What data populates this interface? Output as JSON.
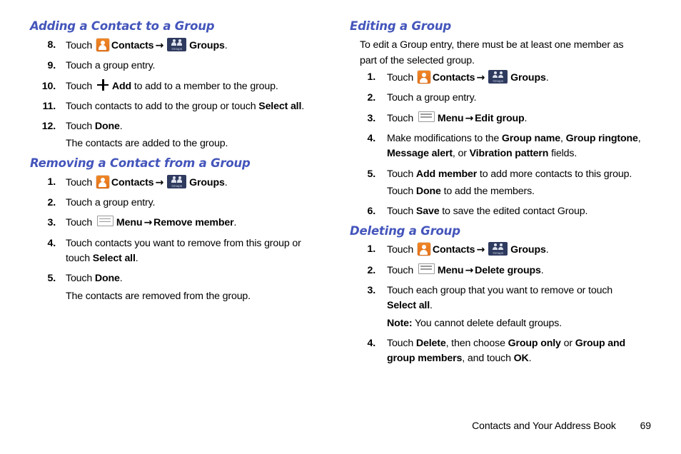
{
  "icons": {
    "contacts": "contacts-icon",
    "groups": "groups-icon",
    "groups_label": "Groups",
    "menu": "menu-icon",
    "add": "add-plus-icon",
    "arrow": "→"
  },
  "colors": {
    "heading_blue": "#4455bb",
    "contacts_icon_orange": "#ef8626",
    "groups_icon_navy": "#2f3a5f",
    "menu_icon_gray": "#9a9a9a",
    "text_black": "#000000",
    "page_background": "#ffffff"
  },
  "left_column": {
    "section1": {
      "heading": "Adding a Contact to a Group",
      "steps": [
        {
          "num": "8.",
          "parts": [
            {
              "t": "text",
              "v": "Touch "
            },
            {
              "t": "icon",
              "v": "contacts"
            },
            {
              "t": "bold",
              "v": "Contacts"
            },
            {
              "t": "arrow"
            },
            {
              "t": "icon",
              "v": "groups"
            },
            {
              "t": "bold",
              "v": "Groups"
            },
            {
              "t": "text",
              "v": "."
            }
          ]
        },
        {
          "num": "9.",
          "parts": [
            {
              "t": "text",
              "v": "Touch a group entry."
            }
          ]
        },
        {
          "num": "10.",
          "parts": [
            {
              "t": "text",
              "v": "Touch "
            },
            {
              "t": "icon",
              "v": "add"
            },
            {
              "t": "bold",
              "v": "Add"
            },
            {
              "t": "text",
              "v": " to add to a member to the group."
            }
          ]
        },
        {
          "num": "11.",
          "parts": [
            {
              "t": "text",
              "v": "Touch contacts to add to the group or touch "
            },
            {
              "t": "bold",
              "v": "Select all"
            },
            {
              "t": "text",
              "v": "."
            }
          ]
        },
        {
          "num": "12.",
          "parts": [
            {
              "t": "text",
              "v": "Touch "
            },
            {
              "t": "bold",
              "v": "Done"
            },
            {
              "t": "text",
              "v": "."
            },
            {
              "t": "br"
            },
            {
              "t": "text",
              "v": "The contacts are added to the group."
            }
          ]
        }
      ]
    },
    "section2": {
      "heading": "Removing a Contact from a Group",
      "steps": [
        {
          "num": "1.",
          "parts": [
            {
              "t": "text",
              "v": "Touch "
            },
            {
              "t": "icon",
              "v": "contacts"
            },
            {
              "t": "bold",
              "v": "Contacts"
            },
            {
              "t": "arrow"
            },
            {
              "t": "icon",
              "v": "groups"
            },
            {
              "t": "bold",
              "v": "Groups"
            },
            {
              "t": "text",
              "v": "."
            }
          ]
        },
        {
          "num": "2.",
          "parts": [
            {
              "t": "text",
              "v": "Touch a group entry."
            }
          ]
        },
        {
          "num": "3.",
          "parts": [
            {
              "t": "text",
              "v": "Touch "
            },
            {
              "t": "icon",
              "v": "menu"
            },
            {
              "t": "bold",
              "v": "Menu"
            },
            {
              "t": "arrow"
            },
            {
              "t": "bold",
              "v": "Remove member"
            },
            {
              "t": "text",
              "v": "."
            }
          ]
        },
        {
          "num": "4.",
          "parts": [
            {
              "t": "text",
              "v": "Touch contacts you want to remove from this group or touch "
            },
            {
              "t": "bold",
              "v": "Select all"
            },
            {
              "t": "text",
              "v": "."
            }
          ]
        },
        {
          "num": "5.",
          "parts": [
            {
              "t": "text",
              "v": "Touch "
            },
            {
              "t": "bold",
              "v": "Done"
            },
            {
              "t": "text",
              "v": "."
            },
            {
              "t": "br"
            },
            {
              "t": "text",
              "v": "The contacts are removed from the group."
            }
          ]
        }
      ]
    }
  },
  "right_column": {
    "section1": {
      "heading": "Editing a Group",
      "intro": "To edit a Group entry, there must be at least one member as part of the selected group.",
      "steps": [
        {
          "num": "1.",
          "parts": [
            {
              "t": "text",
              "v": "Touch "
            },
            {
              "t": "icon",
              "v": "contacts"
            },
            {
              "t": "bold",
              "v": "Contacts"
            },
            {
              "t": "arrow"
            },
            {
              "t": "icon",
              "v": "groups"
            },
            {
              "t": "bold",
              "v": "Groups"
            },
            {
              "t": "text",
              "v": "."
            }
          ]
        },
        {
          "num": "2.",
          "parts": [
            {
              "t": "text",
              "v": "Touch a group entry."
            }
          ]
        },
        {
          "num": "3.",
          "parts": [
            {
              "t": "text",
              "v": "Touch "
            },
            {
              "t": "icon",
              "v": "menu"
            },
            {
              "t": "bold",
              "v": "Menu"
            },
            {
              "t": "arrow"
            },
            {
              "t": "bold",
              "v": "Edit group"
            },
            {
              "t": "text",
              "v": "."
            }
          ]
        },
        {
          "num": "4.",
          "parts": [
            {
              "t": "text",
              "v": "Make modifications to the "
            },
            {
              "t": "bold",
              "v": "Group name"
            },
            {
              "t": "text",
              "v": ", "
            },
            {
              "t": "bold",
              "v": "Group ringtone"
            },
            {
              "t": "text",
              "v": ", "
            },
            {
              "t": "bold",
              "v": "Message alert"
            },
            {
              "t": "text",
              "v": ", or "
            },
            {
              "t": "bold",
              "v": "Vibration pattern"
            },
            {
              "t": "text",
              "v": " fields."
            }
          ]
        },
        {
          "num": "5.",
          "parts": [
            {
              "t": "text",
              "v": "Touch "
            },
            {
              "t": "bold",
              "v": "Add member"
            },
            {
              "t": "text",
              "v": " to add more contacts to this group."
            },
            {
              "t": "br"
            },
            {
              "t": "text",
              "v": "Touch "
            },
            {
              "t": "bold",
              "v": "Done"
            },
            {
              "t": "text",
              "v": " to add the members."
            }
          ]
        },
        {
          "num": "6.",
          "parts": [
            {
              "t": "text",
              "v": "Touch "
            },
            {
              "t": "bold",
              "v": "Save"
            },
            {
              "t": "text",
              "v": " to save the edited contact Group."
            }
          ]
        }
      ]
    },
    "section2": {
      "heading": "Deleting a Group",
      "steps": [
        {
          "num": "1.",
          "parts": [
            {
              "t": "text",
              "v": "Touch "
            },
            {
              "t": "icon",
              "v": "contacts"
            },
            {
              "t": "bold",
              "v": "Contacts"
            },
            {
              "t": "arrow"
            },
            {
              "t": "icon",
              "v": "groups"
            },
            {
              "t": "bold",
              "v": "Groups"
            },
            {
              "t": "text",
              "v": "."
            }
          ]
        },
        {
          "num": "2.",
          "parts": [
            {
              "t": "text",
              "v": "Touch "
            },
            {
              "t": "icon",
              "v": "menu"
            },
            {
              "t": "bold",
              "v": "Menu"
            },
            {
              "t": "arrow"
            },
            {
              "t": "bold",
              "v": "Delete groups"
            },
            {
              "t": "text",
              "v": "."
            }
          ]
        },
        {
          "num": "3.",
          "parts": [
            {
              "t": "text",
              "v": "Touch each group that you want to remove or touch "
            },
            {
              "t": "bold",
              "v": "Select all"
            },
            {
              "t": "text",
              "v": "."
            },
            {
              "t": "br"
            },
            {
              "t": "bold",
              "v": "Note:"
            },
            {
              "t": "text",
              "v": " You cannot delete default groups."
            }
          ]
        },
        {
          "num": "4.",
          "parts": [
            {
              "t": "text",
              "v": "Touch "
            },
            {
              "t": "bold",
              "v": "Delete"
            },
            {
              "t": "text",
              "v": ", then choose "
            },
            {
              "t": "bold",
              "v": "Group only"
            },
            {
              "t": "text",
              "v": " or "
            },
            {
              "t": "bold",
              "v": "Group and group members"
            },
            {
              "t": "text",
              "v": ", and touch "
            },
            {
              "t": "bold",
              "v": "OK"
            },
            {
              "t": "text",
              "v": "."
            }
          ]
        }
      ]
    }
  },
  "footer": {
    "title": "Contacts and Your Address Book",
    "page_number": "69"
  }
}
